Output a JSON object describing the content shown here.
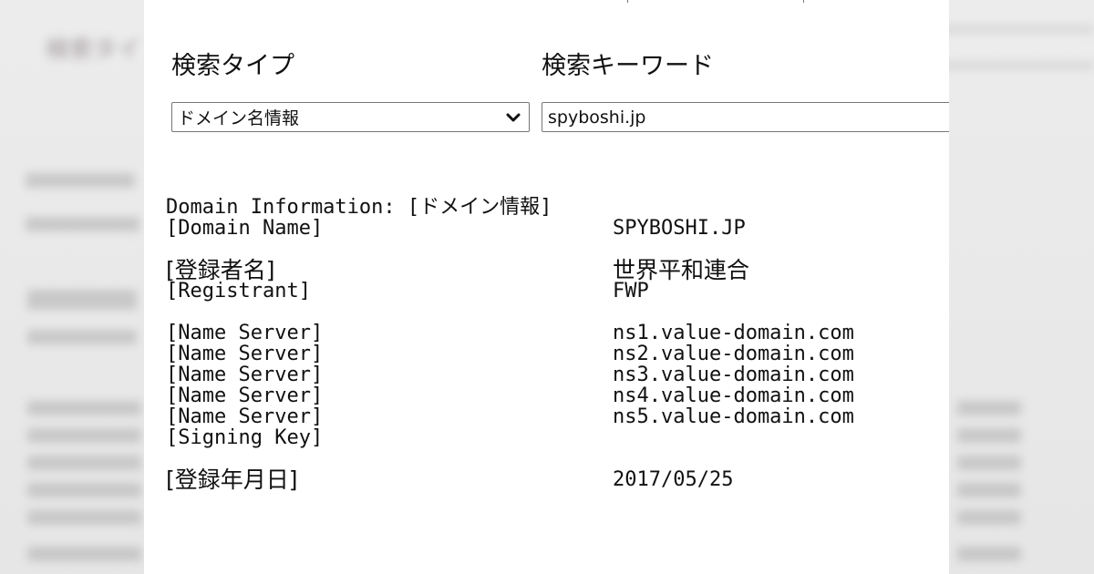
{
  "search_form": {
    "type_label": "検索タイプ",
    "keyword_label": "検索キーワード",
    "type_selected": "ドメイン名情報",
    "keyword_value": "spyboshi.jp"
  },
  "result": {
    "header": "Domain Information: [ドメイン情報]",
    "rows": [
      {
        "key": "[Domain Name]",
        "value": "SPYBOSHI.JP"
      },
      {
        "key": "",
        "value": ""
      },
      {
        "key": "[登録者名]",
        "value": "世界平和連合"
      },
      {
        "key": "[Registrant]",
        "value": "FWP"
      },
      {
        "key": "",
        "value": ""
      },
      {
        "key": "[Name Server]",
        "value": "ns1.value-domain.com"
      },
      {
        "key": "[Name Server]",
        "value": "ns2.value-domain.com"
      },
      {
        "key": "[Name Server]",
        "value": "ns3.value-domain.com"
      },
      {
        "key": "[Name Server]",
        "value": "ns4.value-domain.com"
      },
      {
        "key": "[Name Server]",
        "value": "ns5.value-domain.com"
      },
      {
        "key": "[Signing Key]",
        "value": ""
      },
      {
        "key": "",
        "value": ""
      },
      {
        "key": "[登録年月日]",
        "value": "2017/05/25"
      }
    ]
  },
  "icons": {
    "select_arrow": "chevron-down-icon"
  }
}
